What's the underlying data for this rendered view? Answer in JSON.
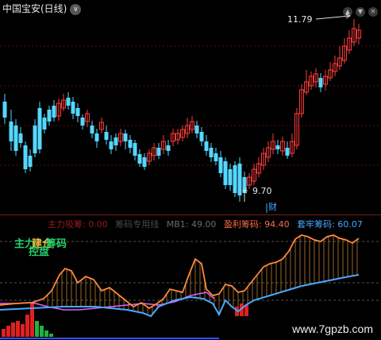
{
  "window": {
    "title": "中国宝安(日线)",
    "chevron": "∨",
    "buttons": [
      "▲",
      "▼",
      "✕"
    ]
  },
  "main": {
    "high_label": "11.79",
    "low_label": "9.70",
    "low_marker": "财"
  },
  "indicator": {
    "labels": [
      {
        "text": "主力吸筹: 0.00",
        "color": "#9b1c1c"
      },
      {
        "text": "筹码专用线",
        "color": "#4a4a4a"
      },
      {
        "text": "MB1: 49.00",
        "color": "#6a6a6a"
      },
      {
        "text": "盈利筹码: 94.40",
        "color": "#ff6a4a"
      },
      {
        "text": "套牢筹码: 60.07",
        "color": "#4aa8ff"
      }
    ],
    "legend_lines": [
      "主力",
      "控盘",
      "筹码"
    ],
    "legend_overlay": "建仓"
  },
  "watermark": "www.7gpzb.com",
  "colors": {
    "up": "#ff3b3b",
    "down": "#54d8ff",
    "profit": "#ff8a3a",
    "trapped": "#4aa8ff",
    "magenta": "#e060ff"
  }
}
